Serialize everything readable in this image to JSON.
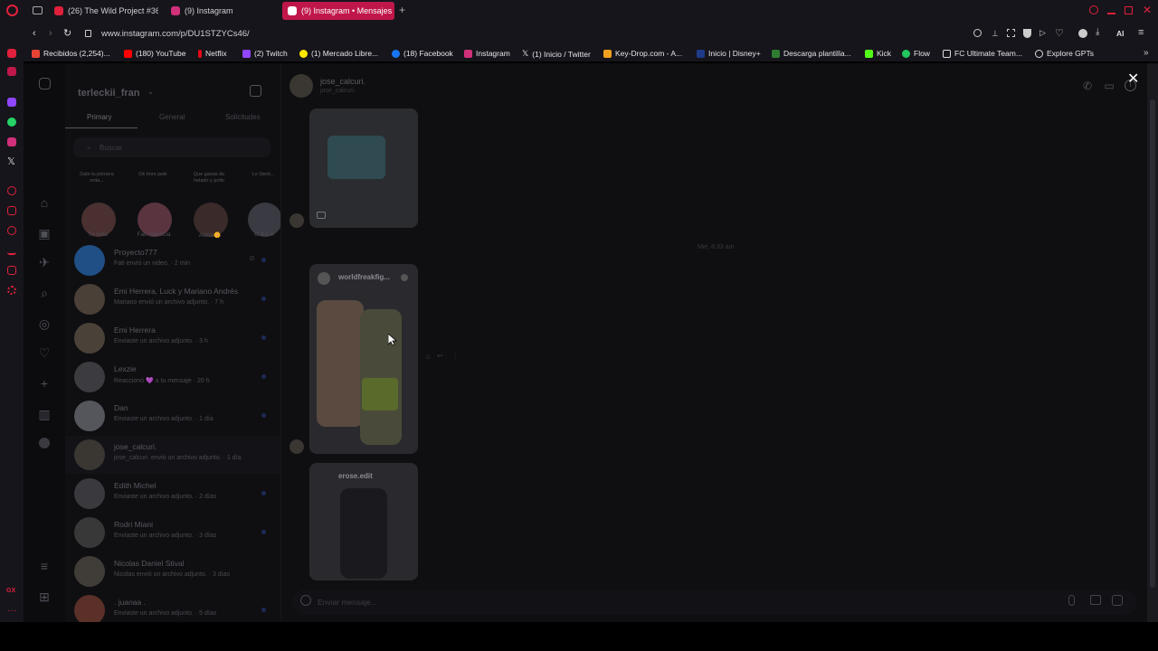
{
  "tabs": [
    {
      "label": "(26) The Wild Project #36",
      "color": "#e0203c"
    },
    {
      "label": "(9) Instagram",
      "color": "#d1307a"
    },
    {
      "label": "(9) Instagram • Mensajes",
      "color": "#ffffff"
    }
  ],
  "new_tab_label": "+",
  "url": "www.instagram.com/p/DU1STZYCs46/",
  "browser_ai_label": "AI",
  "bookmarks": [
    {
      "label": "Recibidos (2,254)...",
      "color": "#ea4335"
    },
    {
      "label": "(180) YouTube",
      "color": "#ff0000"
    },
    {
      "label": "Netflix",
      "color": "#e50914"
    },
    {
      "label": "(2) Twitch",
      "color": "#9146ff"
    },
    {
      "label": "(1) Mercado Libre...",
      "color": "#ffe600"
    },
    {
      "label": "(18) Facebook",
      "color": "#1877f2"
    },
    {
      "label": "Instagram",
      "color": "#d1307a"
    },
    {
      "label": "(1) Inicio / Twitter",
      "color": "#ffffff"
    },
    {
      "label": "Key-Drop.com - A...",
      "color": "#f0a020"
    },
    {
      "label": "Inicio | Disney+",
      "color": "#1e3a8a"
    },
    {
      "label": "Descarga plantilla...",
      "color": "#2e7d32"
    },
    {
      "label": "Kick",
      "color": "#53fc18"
    },
    {
      "label": "Flow",
      "color": "#22c55e"
    },
    {
      "label": "FC Ultimate Team...",
      "color": "#dddddd"
    },
    {
      "label": "Explore GPTs",
      "color": "#dddddd"
    }
  ],
  "inbox": {
    "username": "terleckii_fran",
    "tabs": [
      "Primary",
      "General",
      "Solicitudes"
    ],
    "search_placeholder": "Buscar",
    "stories": [
      {
        "note": "Dale tu primera nota...",
        "name": "Tu nota",
        "color": "#4a3030"
      },
      {
        "note": "Ok tmre jade",
        "name": "Fati Valencia",
        "color": "#5a3540"
      },
      {
        "note": "Que ganas de helado y pollo",
        "name": "Albita🌼",
        "color": "#3a2a2a"
      },
      {
        "note": "Lo Sient...",
        "name": "G A L A",
        "color": "#3a3a42"
      }
    ],
    "conversations": [
      {
        "name": "Proyecto777",
        "sub": "Fati envió un video. · 2 min",
        "color": "#1f4f85"
      },
      {
        "name": "Emi Herrera, Luck y Mariano Andrés",
        "sub": "Mariano envió un archivo adjunto. · 7 h",
        "color": "#4a4038"
      },
      {
        "name": "Emi Herrera",
        "sub": "Enviaste un archivo adjunto. · 3 h",
        "color": "#4a4238"
      },
      {
        "name": "Lexzie",
        "sub": "Reaccionó 💜 a tu mensaje · 20 h",
        "color": "#3c3c40"
      },
      {
        "name": "Dan",
        "sub": "Enviaste un archivo adjunto. · 1 día",
        "color": "#55555c"
      },
      {
        "name": "jose_calcuri.",
        "sub": "jose_calcuri. envió un archivo adjunto. · 1 día",
        "color": "#3a3632"
      },
      {
        "name": "Edith Michel",
        "sub": "Enviaste un archivo adjunto. · 2 días",
        "color": "#3a3a3e"
      },
      {
        "name": "Rodri Miani",
        "sub": "Enviaste un archivo adjunto. · 3 días",
        "color": "#383838"
      },
      {
        "name": "Nicolas Daniel Stival",
        "sub": "Nicolas envió un archivo adjunto. · 3 días",
        "color": "#403c38"
      },
      {
        "name": ". juanaa .",
        "sub": "Enviaste un archivo adjunto. · 5 días",
        "color": "#5a3028"
      }
    ]
  },
  "chat": {
    "name": "jose_calcuri.",
    "handle": "jose_calcuri.",
    "timestamp": "Mié, 8:33 am",
    "media_title_1": "worldfreakfig...",
    "media_title_2": "erose.edit",
    "composer_placeholder": "Enviar mensaje..."
  },
  "close_label": "✕",
  "chart_data": null
}
